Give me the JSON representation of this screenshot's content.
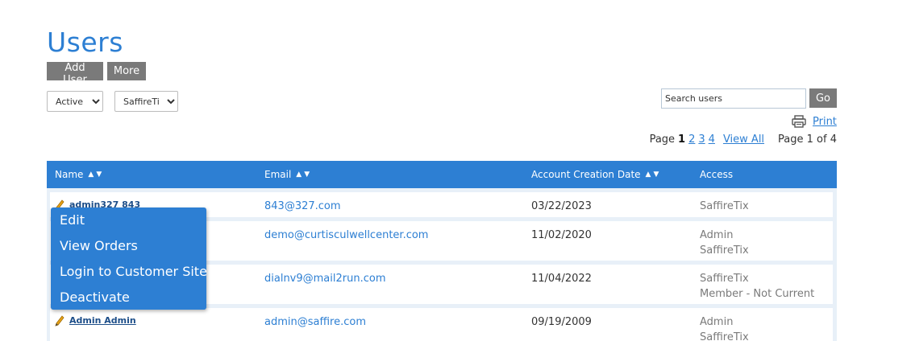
{
  "page": {
    "title": "Users"
  },
  "toolbar": {
    "add_user_label": "Add User",
    "more_label": "More"
  },
  "filters": {
    "status": {
      "selected": "Active"
    },
    "site": {
      "selected": "SaffireTix"
    }
  },
  "search": {
    "placeholder": "Search users",
    "go_label": "Go"
  },
  "print": {
    "label": "Print",
    "icon": "printer-icon"
  },
  "pagination": {
    "prefix": "Page",
    "pages": [
      "1",
      "2",
      "3",
      "4"
    ],
    "current": "1",
    "view_all": "View All",
    "page_of": "Page 1 of 4"
  },
  "table": {
    "columns": [
      "Name",
      "Email",
      "Account Creation Date",
      "Access"
    ],
    "rows": [
      {
        "name": "admin327 843",
        "email": "843@327.com",
        "date": "03/22/2023",
        "access": [
          "SaffireTix"
        ]
      },
      {
        "name": "",
        "email": "demo@curtisculwellcenter.com",
        "date": "11/02/2020",
        "access": [
          "Admin",
          "SaffireTix"
        ]
      },
      {
        "name": "",
        "email": "dialnv9@mail2run.com",
        "date": "11/04/2022",
        "access": [
          "SaffireTix",
          "Member - Not Current"
        ]
      },
      {
        "name": "Admin Admin",
        "email": "admin@saffire.com",
        "date": "09/19/2009",
        "access": [
          "Admin",
          "SaffireTix"
        ]
      }
    ]
  },
  "context_menu": {
    "items": [
      "Edit",
      "View Orders",
      "Login to Customer Site",
      "Deactivate"
    ]
  },
  "colors": {
    "accent": "#2d7fd3",
    "button_gray": "#7a7a7a",
    "table_bg": "#e8f0f8"
  }
}
